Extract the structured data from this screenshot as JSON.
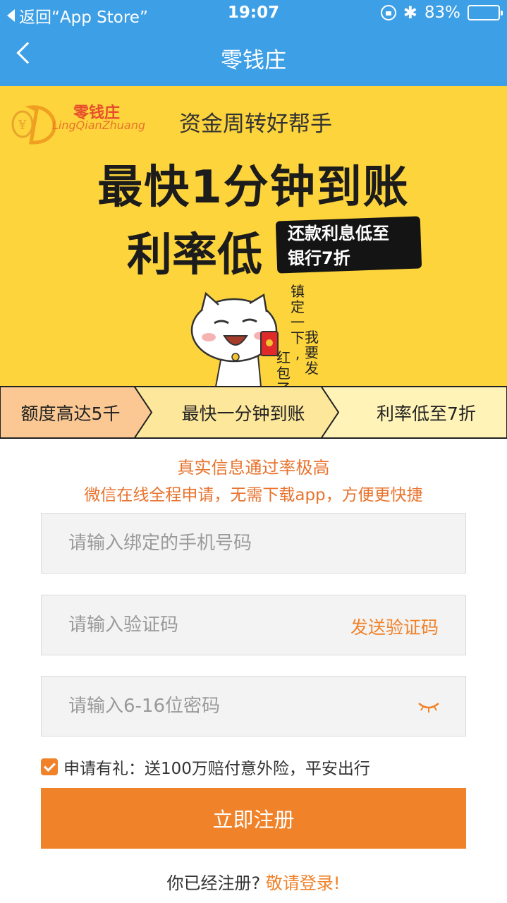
{
  "status_bar": {
    "back_app": "返回“App Store”",
    "time": "19:07",
    "battery": "83%",
    "battery_level": 0.83
  },
  "nav": {
    "title": "零钱庄"
  },
  "banner": {
    "logo_cn": "零钱庄",
    "logo_en": "LingQianZhuang",
    "tagline": "资金周转好帮手",
    "headline_1": "最快1分钟到账",
    "headline_2": "利率低",
    "ink_line_1": "还款利息低至",
    "ink_line_2": "银行7折",
    "vertical_text_1": "镇定一下,",
    "vertical_text_2": "我要发",
    "vertical_text_3": "红包了",
    "benefits": [
      "额度高达5千",
      "最快一分钟到账",
      "利率低至7折"
    ]
  },
  "form": {
    "notice_1": "真实信息通过率极高",
    "notice_2": "微信在线全程申请，无需下载app，方便更快捷",
    "phone_placeholder": "请输入绑定的手机号码",
    "code_placeholder": "请输入验证码",
    "send_code": "发送验证码",
    "password_placeholder": "请输入6-16位密码",
    "agree_text": "申请有礼：送100万赔付意外险，平安出行",
    "agree_checked": true,
    "register_button": "立即注册",
    "login_question": "你已经注册?",
    "login_link": "敬请登录!"
  },
  "colors": {
    "nav_blue": "#3d9fe6",
    "banner_yellow": "#fdd43b",
    "accent_orange": "#f0822a"
  }
}
